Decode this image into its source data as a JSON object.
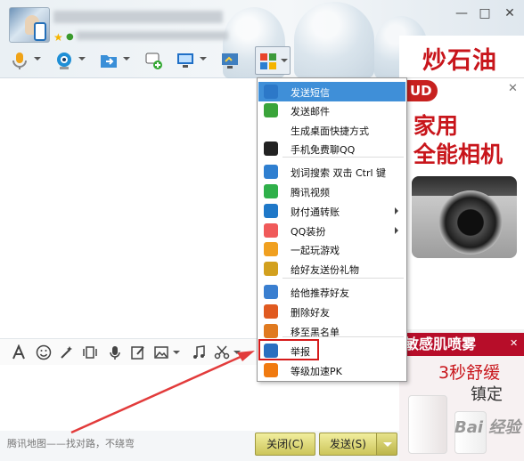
{
  "window": {
    "minimize_glyph": "—",
    "maximize_glyph": "□",
    "close_glyph": "✕"
  },
  "ads": {
    "top_banner": "炒石油",
    "camera": {
      "brand": "UD",
      "line1": "家用",
      "line2": "全能相机",
      "close": "✕"
    },
    "skin": {
      "headline": "敏感肌喷雾",
      "line1": "3秒舒缓",
      "line2": "镇定",
      "close": "✕"
    },
    "watermark": "Bai 经验"
  },
  "menu": {
    "items": [
      {
        "label": "发送短信",
        "icon": "sms-icon",
        "highlighted": true
      },
      {
        "label": "发送邮件",
        "icon": "mail-icon"
      },
      {
        "label": "生成桌面快捷方式",
        "icon": "none"
      },
      {
        "label": "手机免费聊QQ",
        "icon": "qq-icon"
      },
      {
        "label": "划词搜索 双击 Ctrl 键",
        "icon": "magnifier-icon"
      },
      {
        "label": "腾讯视频",
        "icon": "video-icon"
      },
      {
        "label": "财付通转账",
        "icon": "shield-icon",
        "submenu": true
      },
      {
        "label": "QQ装扮",
        "icon": "pinwheel-icon",
        "submenu": true
      },
      {
        "label": "一起玩游戏",
        "icon": "game-icon"
      },
      {
        "label": "给好友送份礼物",
        "icon": "gift-icon"
      },
      {
        "label": "给他推荐好友",
        "icon": "recommend-icon"
      },
      {
        "label": "删除好友",
        "icon": "delete-friend-icon"
      },
      {
        "label": "移至黑名单",
        "icon": "blacklist-icon"
      },
      {
        "label": "举报",
        "icon": "report-icon"
      },
      {
        "label": "等级加速PK",
        "icon": "level-icon"
      }
    ]
  },
  "footer": {
    "map_link": "腾讯地图——找对路，不绕弯",
    "close_button": "关闭(C)",
    "send_button": "发送(S)"
  },
  "colors": {
    "menu_highlight": "#3f8fd8",
    "button_gold": "#ccc55a",
    "ad_red": "#c8151b"
  }
}
